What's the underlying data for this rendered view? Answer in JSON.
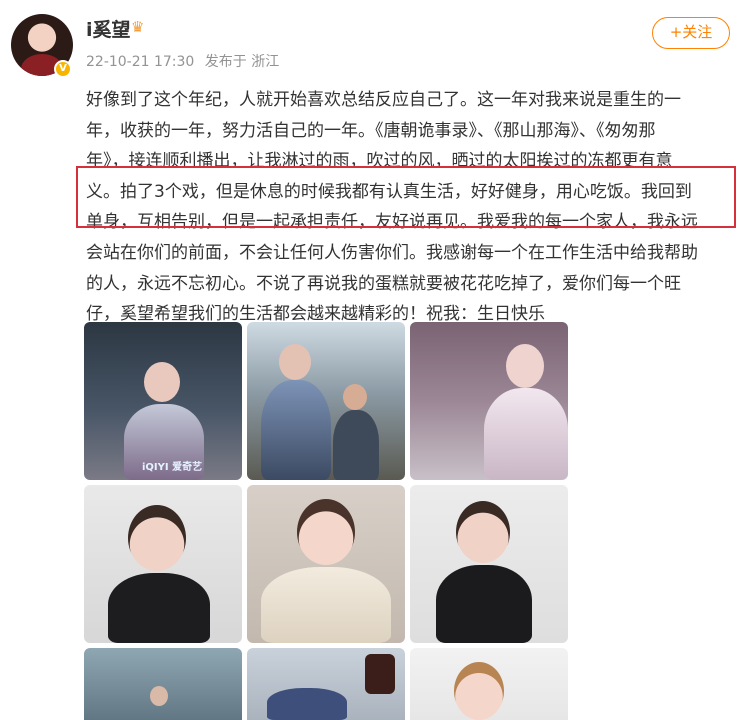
{
  "post": {
    "username": "i奚望",
    "timestamp": "22-10-21 17:30",
    "source": "发布于 浙江",
    "follow_label": "+关注",
    "lines": [
      "好像到了这个年纪，人就开始喜欢总结反应自己了。这一年对我来说是重生的一",
      "年，收获的一年，努力活自己的一年。《唐朝诡事录》、《那山那海》、《匆匆那",
      "年》，接连顺利播出，让我淋过的雨，吹过的风，晒过的太阳挨过的冻都更有意",
      "义。拍了3个戏，但是休息的时候我都有认真生活，好好健身，用心吃饭。我回到",
      "单身，互相告别，但是一起承担责任，友好说再见。我爱我的每一个家人，我永远",
      "会站在你们的前面，不会让任何人伤害你们。我感谢每一个在工作生活中给我帮助",
      "的人，永远不忘初心。不说了再说我的蛋糕就要被花花吃掉了，爱你们每一个旺",
      "仔，奚望希望我们的生活都会越来越精彩的！祝我：生日快乐"
    ]
  },
  "icons": {
    "vip": "crown-badge-icon",
    "verified": "verified-v-icon"
  },
  "photos": [
    {
      "label": "drama-still-1",
      "watermark": "iQIYI 爱奇艺"
    },
    {
      "label": "drama-still-2"
    },
    {
      "label": "drama-still-3"
    },
    {
      "label": "portrait-1"
    },
    {
      "label": "portrait-2"
    },
    {
      "label": "portrait-3"
    },
    {
      "label": "daily-photo-1"
    },
    {
      "label": "daily-photo-2"
    },
    {
      "label": "daily-photo-3"
    }
  ],
  "colors": {
    "accent": "#ff8200",
    "highlight": "#d4313d",
    "meta": "#939393"
  }
}
